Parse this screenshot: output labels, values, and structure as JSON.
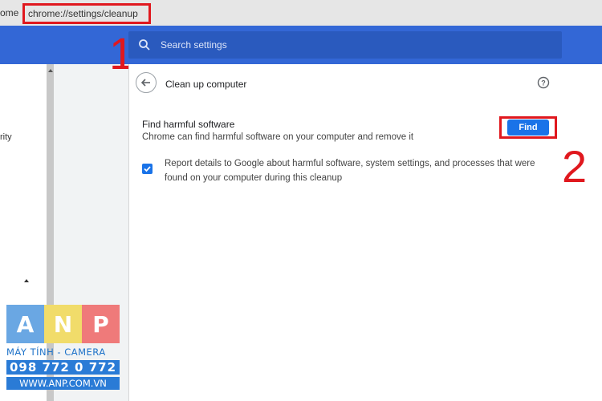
{
  "browser": {
    "prev_tab_text": "ome",
    "url": "chrome://settings/cleanup"
  },
  "header": {
    "search_placeholder": "Search settings"
  },
  "annotations": {
    "step1": "1",
    "step2": "2",
    "highlight_color": "#e0181e"
  },
  "sidebar": {
    "item_fragment": "rity"
  },
  "page": {
    "title": "Clean up computer",
    "section_title": "Find harmful software",
    "section_desc": "Chrome can find harmful software on your computer and remove it",
    "find_button": "Find",
    "report_checked": true,
    "report_text": "Report details to Google about harmful software, system settings, and processes that were found on your computer during this cleanup"
  },
  "icons": {
    "search": "search-icon",
    "back": "arrow-back-icon",
    "help": "help-icon",
    "check": "check-icon"
  },
  "watermark": {
    "letters": [
      "A",
      "N",
      "P"
    ],
    "letter_colors": [
      "#6aa7e3",
      "#f1dc6a",
      "#ef7a7a"
    ],
    "tagline": "MÁY TÍNH - CAMERA",
    "phone": "098 772 0 772",
    "website": "WWW.ANP.COM.VN"
  },
  "colors": {
    "header": "#3367d6",
    "accent": "#1a73e8"
  }
}
